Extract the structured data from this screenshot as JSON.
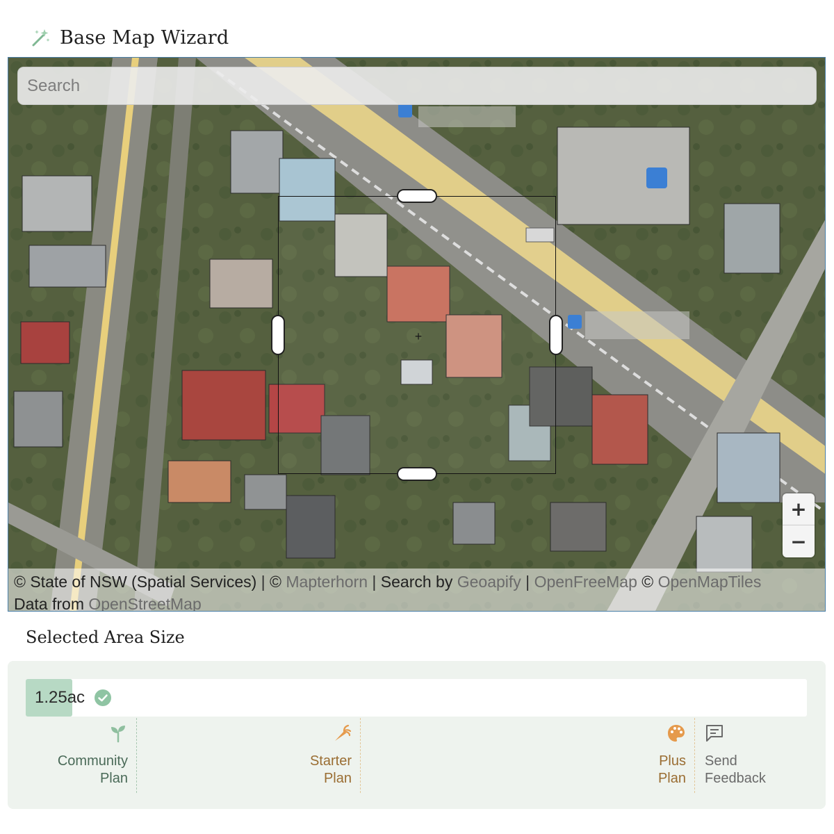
{
  "header": {
    "title": "Base Map Wizard",
    "icon": "magic-wand-icon"
  },
  "map": {
    "search_placeholder": "Search",
    "zoom_in_label": "+",
    "zoom_out_label": "−",
    "attribution": {
      "nsw": "© State of NSW (Spatial Services)",
      "sep1": " | ",
      "mapterhorn_prefix": "© ",
      "mapterhorn": "Mapterhorn",
      "sep2": " | ",
      "search_by": "Search by ",
      "geoapify": "Geoapify",
      "sep3": " | ",
      "openfreemap": "OpenFreeMap",
      "omt_prefix": " © ",
      "openmaptiles": "OpenMapTiles",
      "data_from": "Data from ",
      "openstreetmap": "OpenStreetMap"
    }
  },
  "area": {
    "heading": "Selected Area Size",
    "size_value": "1.25ac",
    "fill_fraction": 0.06,
    "status_icon": "check-circle-icon",
    "accent_color": "#b7d9c4"
  },
  "tiers": [
    {
      "name_line1": "Community",
      "name_line2": "Plan",
      "icon": "sprout-icon",
      "color": "#8fbf9f"
    },
    {
      "name_line1": "Starter",
      "name_line2": "Plan",
      "icon": "carrot-icon",
      "color": "#e59a4c"
    },
    {
      "name_line1": "Plus",
      "name_line2": "Plan",
      "icon": "palette-icon",
      "color": "#e59a4c"
    }
  ],
  "feedback": {
    "line1": "Send",
    "line2": "Feedback",
    "icon": "message-icon"
  }
}
